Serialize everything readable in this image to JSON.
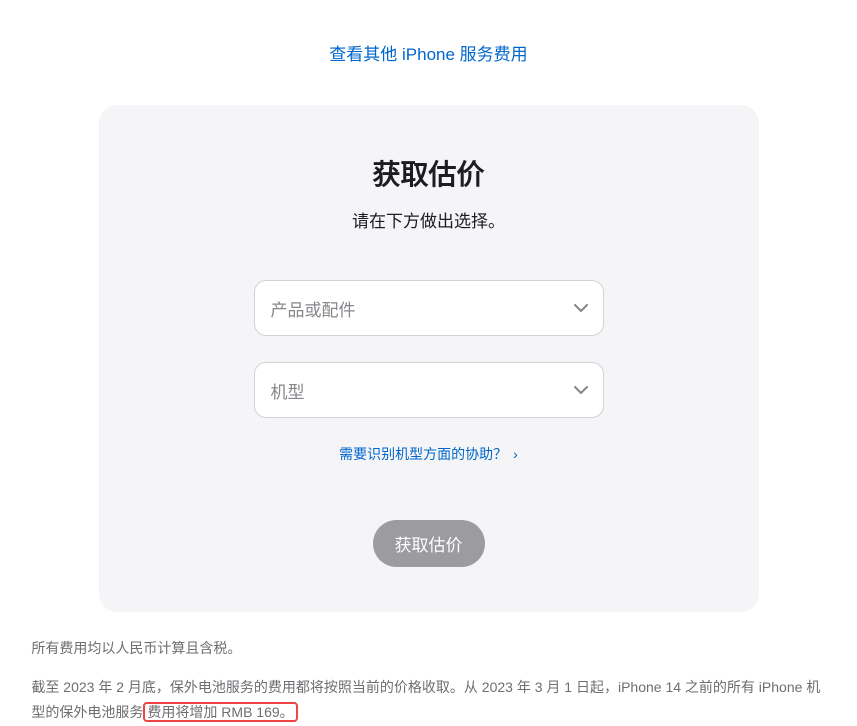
{
  "topLink": {
    "text": "查看其他 iPhone 服务费用"
  },
  "card": {
    "title": "获取估价",
    "subtitle": "请在下方做出选择。",
    "select1": {
      "placeholder": "产品或配件"
    },
    "select2": {
      "placeholder": "机型"
    },
    "helpLink": "需要识别机型方面的协助？",
    "submitButton": "获取估价"
  },
  "footer": {
    "line1": "所有费用均以人民币计算且含税。",
    "line2_part1": "截至 2023 年 2 月底，保外电池服务的费用都将按照当前的价格收取。从 2023 年 3 月 1 日起，iPhone 14 之前的所有 iPhone 机型的保外电池服务",
    "line2_highlight": "费用将增加 RMB 169。"
  }
}
